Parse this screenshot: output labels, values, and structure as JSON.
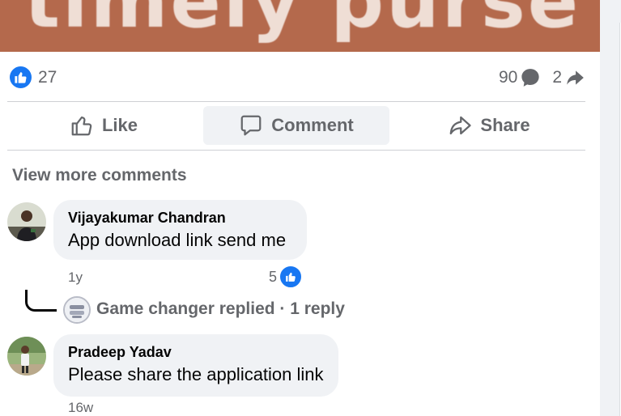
{
  "post": {
    "banner_text": "timely purse"
  },
  "reactions": {
    "like_count": "27"
  },
  "stats": {
    "comments_count": "90",
    "shares_count": "2"
  },
  "actions": {
    "like_label": "Like",
    "comment_label": "Comment",
    "share_label": "Share"
  },
  "comments_section": {
    "view_more_label": "View more comments",
    "comments": [
      {
        "author": "Vijayakumar Chandran",
        "text": "App download link send me",
        "time": "1y",
        "like_count": "5",
        "replies_summary": "Game changer replied · 1 reply"
      },
      {
        "author": "Pradeep Yadav",
        "text": "Please share the application link",
        "time": "16w"
      }
    ]
  },
  "colors": {
    "accent": "#1877f2",
    "muted_text": "#65676b",
    "bubble": "#f0f2f5",
    "banner": "#b4694c"
  },
  "icons": {
    "reaction": "like-thumb-icon",
    "comments": "speech-bubble-icon",
    "shares": "share-arrow-icon",
    "like_action": "thumb-up-outline-icon",
    "comment_action": "comment-outline-icon",
    "share_action": "share-outline-icon"
  }
}
